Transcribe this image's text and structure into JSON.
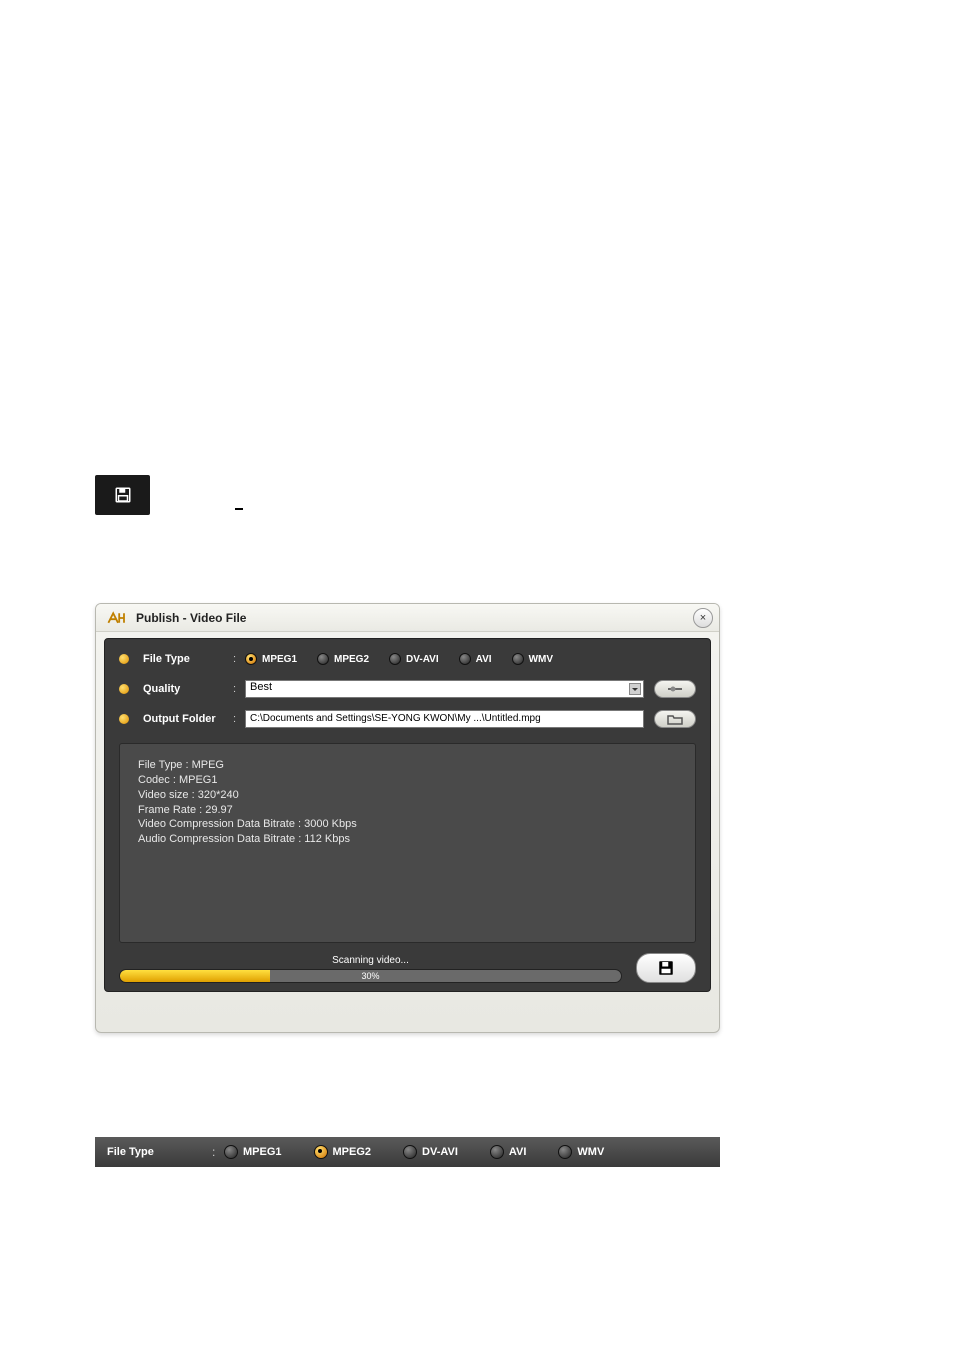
{
  "dialog": {
    "title": "Publish - Video File",
    "close_label": "×",
    "file_type": {
      "label": "File Type",
      "options": [
        "MPEG1",
        "MPEG2",
        "DV-AVI",
        "AVI",
        "WMV"
      ],
      "selected": "MPEG1"
    },
    "quality": {
      "label": "Quality",
      "value": "Best"
    },
    "output": {
      "label": "Output Folder",
      "value": "C:\\Documents and Settings\\SE-YONG KWON\\My ...\\Untitled.mpg"
    },
    "info": {
      "l1": "File Type : MPEG",
      "l2": "Codec : MPEG1",
      "l3": "Video size : 320*240",
      "l4": "Frame Rate : 29.97",
      "l5": "Video Compression Data Bitrate : 3000 Kbps",
      "l6": "Audio Compression Data Bitrate : 112 Kbps"
    },
    "progress": {
      "status": "Scanning video...",
      "percent_text": "30%",
      "percent": 30
    }
  },
  "bottom_row": {
    "label": "File Type",
    "options": [
      "MPEG1",
      "MPEG2",
      "DV-AVI",
      "AVI",
      "WMV"
    ],
    "selected": "MPEG2"
  }
}
